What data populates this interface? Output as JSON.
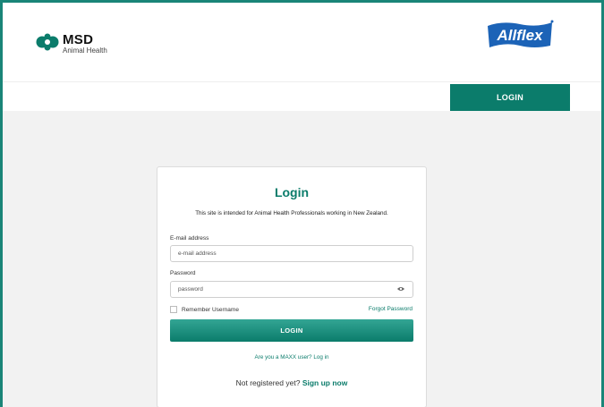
{
  "colors": {
    "brand": "#0b7c6b",
    "frame": "#1a8578",
    "background": "#f2f2f2"
  },
  "header": {
    "msd_logo": {
      "name": "MSD",
      "subtitle": "Animal Health",
      "icon": "msd-logo-icon"
    },
    "partner_logo": {
      "text": "Allflex",
      "icon": "allflex-logo-icon"
    }
  },
  "nav": {
    "login_label": "LOGIN"
  },
  "login": {
    "title": "Login",
    "intro": "This site is intended for Animal Health Professionals working in New Zealand.",
    "email": {
      "label": "E-mail address",
      "placeholder": "e-mail address"
    },
    "password": {
      "label": "Password",
      "placeholder": "password",
      "icon": "eye-icon"
    },
    "remember_label": "Remember Username",
    "forgot_label": "Forgot Password",
    "submit_label": "LOGIN",
    "maxx_link": "Are you a MAXX user? Log in",
    "signup_prompt": "Not registered yet?",
    "signup_link": "Sign up now"
  }
}
